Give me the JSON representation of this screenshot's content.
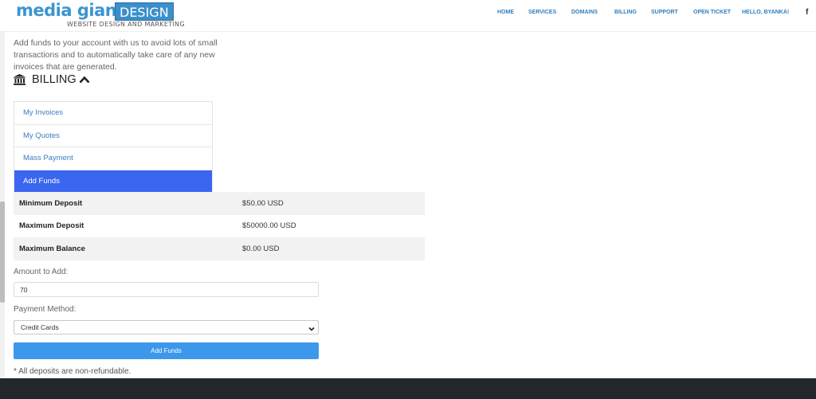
{
  "brand": {
    "name": "media giant",
    "name_box": "DESIGN",
    "tagline": "WEBSITE DESIGN AND MARKETING",
    "primary_color": "#3b95cf"
  },
  "nav": {
    "items": [
      "HOME",
      "SERVICES",
      "DOMAINS",
      "BILLING",
      "SUPPORT",
      "OPEN TICKET",
      "HELLO, BYANKA!"
    ],
    "social_icon": "facebook-icon",
    "social_label": "f"
  },
  "intro_text": "Add funds to your account with us to avoid lots of small transactions and to automatically take care of any new invoices that are generated.",
  "billing": {
    "title": "BILLING",
    "icon": "bank-icon",
    "toggle_icon": "chevron-up-icon",
    "menu": [
      {
        "label": "My Invoices",
        "active": false
      },
      {
        "label": "My Quotes",
        "active": false
      },
      {
        "label": "Mass Payment",
        "active": false
      },
      {
        "label": "Add Funds",
        "active": true
      }
    ],
    "active_color": "#3b66f0"
  },
  "limits": [
    {
      "label": "Minimum Deposit",
      "value": "$50.00 USD"
    },
    {
      "label": "Maximum Deposit",
      "value": "$50000.00 USD"
    },
    {
      "label": "Maximum Balance",
      "value": "$0.00 USD"
    }
  ],
  "form": {
    "amount_label": "Amount to Add:",
    "amount_value": "70",
    "method_label": "Payment Method:",
    "method_selected": "Credit Cards",
    "submit_label": "Add Funds",
    "button_color": "#3d97ea"
  },
  "note": "* All deposits are non-refundable.",
  "footer_color": "#23262b"
}
